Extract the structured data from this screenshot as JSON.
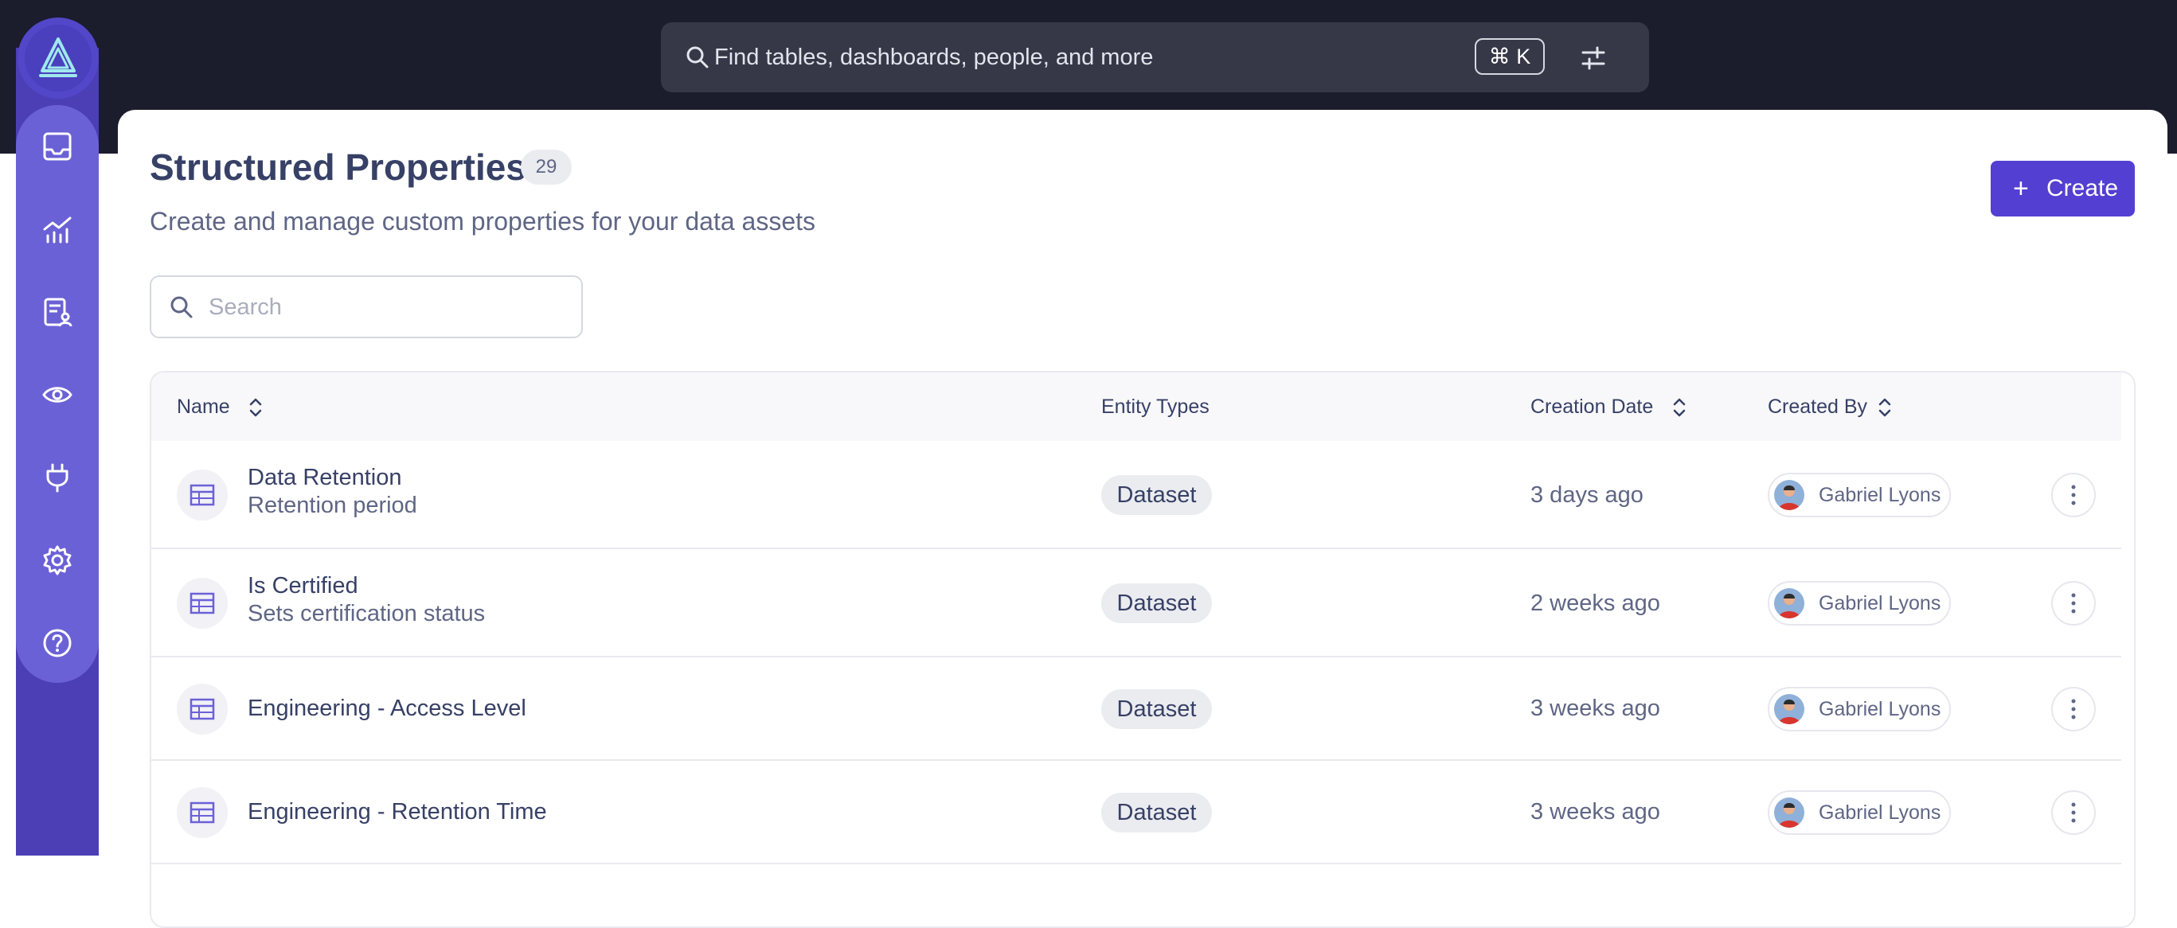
{
  "topbar": {
    "search_placeholder": "Find tables, dashboards, people, and more",
    "shortcut": "⌘ K"
  },
  "sidebar": {
    "items": [
      {
        "name": "inbox-icon"
      },
      {
        "name": "analytics-icon"
      },
      {
        "name": "governance-icon"
      },
      {
        "name": "observe-icon"
      },
      {
        "name": "ingestion-icon"
      },
      {
        "name": "settings-icon"
      },
      {
        "name": "help-icon"
      }
    ]
  },
  "page": {
    "title": "Structured Properties",
    "count": "29",
    "subtitle": "Create and manage custom properties for your data assets",
    "create_label": "Create",
    "search_placeholder": "Search"
  },
  "table": {
    "columns": {
      "name": "Name",
      "entity_types": "Entity Types",
      "creation_date": "Creation Date",
      "created_by": "Created By"
    },
    "rows": [
      {
        "name": "Data Retention",
        "description": "Retention period",
        "entity": "Dataset",
        "date": "3 days ago",
        "user": "Gabriel Lyons"
      },
      {
        "name": "Is Certified",
        "description": "Sets certification status",
        "entity": "Dataset",
        "date": "2 weeks ago",
        "user": "Gabriel Lyons"
      },
      {
        "name": "Engineering - Access Level",
        "description": "",
        "entity": "Dataset",
        "date": "3 weeks ago",
        "user": "Gabriel Lyons"
      },
      {
        "name": "Engineering - Retention Time",
        "description": "",
        "entity": "Dataset",
        "date": "3 weeks ago",
        "user": "Gabriel Lyons"
      }
    ]
  },
  "colors": {
    "accent": "#533fd1",
    "sidebar": "#6b61d6",
    "topbar": "#1b1c2c"
  }
}
